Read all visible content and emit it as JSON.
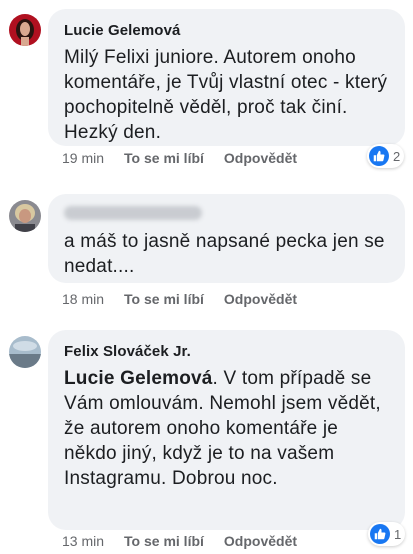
{
  "actions": {
    "like_label": "To se mi líbí",
    "reply_label": "Odpovědět"
  },
  "comments": [
    {
      "author": "Lucie Gelemová",
      "text": "Milý Felixi juniore. Autorem onoho komentáře, je Tvůj vlastní otec - který pochopitelně věděl, proč tak činí. Hezký den.",
      "time": "19 min",
      "reaction_count": "2"
    },
    {
      "author": "",
      "text": "a máš to jasně napsané pecka jen se nedat....",
      "time": "18 min",
      "reaction_count": ""
    },
    {
      "author": "Felix Slováček Jr.",
      "mention": "Lucie Gelemová",
      "text": ". V tom případě se Vám omlouvám. Nemohl jsem vědět, že autorem onoho komentáře je někdo jiný, když je to na vašem Instagramu. Dobrou noc.",
      "time": "13 min",
      "reaction_count": "1"
    }
  ],
  "colors": {
    "bubble": "#f0f2f5",
    "like_blue": "#1877f2",
    "meta_gray": "#65676b"
  },
  "icons": {
    "reaction": "like-thumb-icon"
  }
}
